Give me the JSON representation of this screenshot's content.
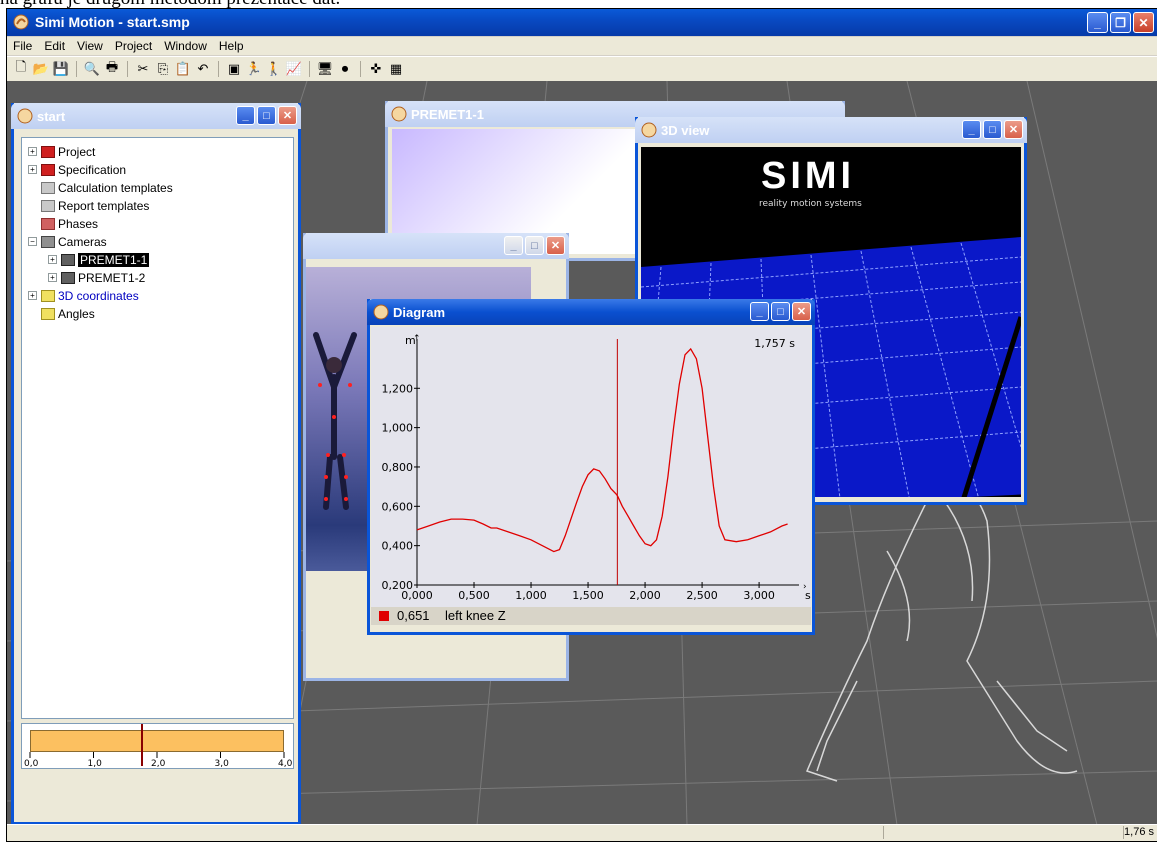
{
  "caption": "na grafu je drugom metodom prezentace dat.",
  "app": {
    "title": "Simi Motion - start.smp",
    "controls": [
      "_",
      "❐",
      "✕"
    ]
  },
  "menu": [
    "File",
    "Edit",
    "View",
    "Project",
    "Window",
    "Help"
  ],
  "toolbar_icons": [
    "new-icon",
    "open-icon",
    "save-icon",
    "sep",
    "print-preview-icon",
    "print-icon",
    "sep",
    "cut-icon",
    "copy-icon",
    "paste-icon",
    "undo-icon",
    "sep",
    "camera-view-icon",
    "stick-figure-icon",
    "walking-figure-icon",
    "chart-icon",
    "sep",
    "monitor-icon",
    "record-icon",
    "sep",
    "skeleton-icon",
    "table-icon"
  ],
  "windows": {
    "start": {
      "title": "start"
    },
    "premet": {
      "title": "PREMET1-1"
    },
    "view3d": {
      "title": "3D view",
      "logo": "SIMI",
      "tagline": "reality motion systems"
    },
    "video": {
      "title": ""
    },
    "diagram": {
      "title": "Diagram",
      "time_label": "1,757 s",
      "y_unit": "m",
      "x_unit": "s",
      "legend_value": "0,651",
      "legend_name": "left knee Z",
      "legend_color": "#e00000"
    }
  },
  "tree": [
    {
      "label": "Project",
      "expander": "+",
      "icon": "red-book-icon",
      "indent": 0,
      "color": "#000"
    },
    {
      "label": "Specification",
      "expander": "+",
      "icon": "red-book-icon",
      "indent": 0,
      "color": "#000"
    },
    {
      "label": "Calculation templates",
      "expander": "",
      "icon": "gray-folder-icon",
      "indent": 0,
      "color": "#000"
    },
    {
      "label": "Report templates",
      "expander": "",
      "icon": "gray-folder-icon",
      "indent": 0,
      "color": "#000"
    },
    {
      "label": "Phases",
      "expander": "",
      "icon": "red-folder-icon",
      "indent": 0,
      "color": "#000"
    },
    {
      "label": "Cameras",
      "expander": "−",
      "icon": "camera-folder-icon",
      "indent": 0,
      "color": "#000"
    },
    {
      "label": "PREMET1-1",
      "expander": "+",
      "icon": "camera-icon",
      "indent": 1,
      "color": "#fff",
      "selected": true
    },
    {
      "label": "PREMET1-2",
      "expander": "+",
      "icon": "camera-icon",
      "indent": 1,
      "color": "#000"
    },
    {
      "label": "3D coordinates",
      "expander": "+",
      "icon": "yellow-folder-icon",
      "indent": 0,
      "color": "#0000c0"
    },
    {
      "label": "Angles",
      "expander": "",
      "icon": "yellow-folder-icon",
      "indent": 0,
      "color": "#000"
    }
  ],
  "timeline": {
    "ticks": [
      "0,0",
      "1,0",
      "2,0",
      "3,0",
      "4,0"
    ],
    "min": 0,
    "max": 4,
    "cursor": 1.76
  },
  "status": {
    "time": "1,76 s"
  },
  "chart_data": {
    "type": "line",
    "title": "",
    "xlabel": "s",
    "ylabel": "m",
    "xlim": [
      0,
      3.35
    ],
    "ylim": [
      0.2,
      1.42
    ],
    "xticks": [
      "0,000",
      "0,500",
      "1,000",
      "1,500",
      "2,000",
      "2,500",
      "3,000"
    ],
    "yticks": [
      "0,200",
      "0,400",
      "0,600",
      "0,800",
      "1,000",
      "1,200"
    ],
    "cursor_x": 1.757,
    "grid": false,
    "series": [
      {
        "name": "left knee Z",
        "color": "#e00000",
        "x": [
          0,
          0.1,
          0.2,
          0.3,
          0.4,
          0.5,
          0.58,
          0.65,
          0.7,
          0.8,
          0.9,
          1.0,
          1.1,
          1.2,
          1.25,
          1.3,
          1.4,
          1.45,
          1.5,
          1.55,
          1.6,
          1.65,
          1.7,
          1.75,
          1.76,
          1.8,
          1.85,
          1.9,
          1.95,
          2.0,
          2.05,
          2.1,
          2.15,
          2.2,
          2.25,
          2.3,
          2.35,
          2.4,
          2.45,
          2.5,
          2.55,
          2.6,
          2.65,
          2.7,
          2.8,
          2.9,
          3.0,
          3.1,
          3.2,
          3.25
        ],
        "y": [
          0.48,
          0.5,
          0.52,
          0.535,
          0.535,
          0.53,
          0.51,
          0.49,
          0.49,
          0.47,
          0.45,
          0.43,
          0.4,
          0.37,
          0.38,
          0.45,
          0.62,
          0.7,
          0.76,
          0.79,
          0.78,
          0.74,
          0.69,
          0.66,
          0.651,
          0.6,
          0.55,
          0.5,
          0.45,
          0.41,
          0.4,
          0.43,
          0.55,
          0.75,
          1.0,
          1.22,
          1.37,
          1.4,
          1.35,
          1.2,
          0.95,
          0.7,
          0.5,
          0.43,
          0.42,
          0.43,
          0.45,
          0.47,
          0.5,
          0.51
        ]
      }
    ]
  }
}
